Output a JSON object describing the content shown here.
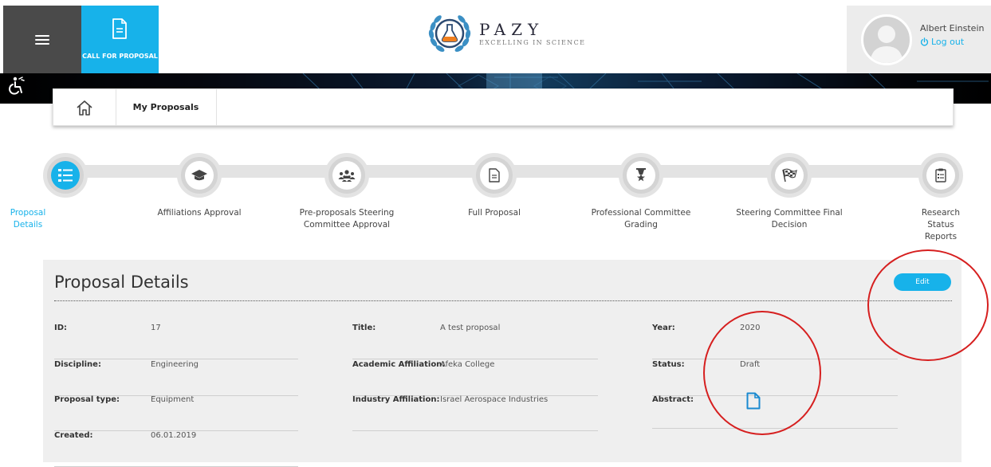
{
  "header": {
    "call_for_proposal_label": "CALL FOR PROPOSAL",
    "logo_name": "PAZY",
    "logo_tagline": "EXCELLING IN SCIENCE",
    "user_name": "Albert Einstein",
    "logout_label": "Log out"
  },
  "breadcrumb": {
    "current": "My Proposals"
  },
  "steps": [
    {
      "label": "Proposal Details",
      "icon": "list-icon",
      "active": true
    },
    {
      "label": "Affiliations Approval",
      "icon": "graduation-cap-icon",
      "active": false
    },
    {
      "label": "Pre-proposals Steering Committee Approval",
      "icon": "group-icon",
      "active": false
    },
    {
      "label": "Full Proposal",
      "icon": "document-icon",
      "active": false
    },
    {
      "label": "Professional Committee Grading",
      "icon": "award-icon",
      "active": false
    },
    {
      "label": "Steering Committee Final Decision",
      "icon": "checkered-flag-icon",
      "active": false
    },
    {
      "label": "Research Status Reports",
      "icon": "clipboard-icon",
      "active": false
    }
  ],
  "details": {
    "title": "Proposal Details",
    "edit_label": "Edit",
    "col1": [
      {
        "label": "ID:",
        "value": "17"
      },
      {
        "label": "Discipline:",
        "value": "Engineering"
      },
      {
        "label": "Proposal type:",
        "value": "Equipment"
      },
      {
        "label": "Created:",
        "value": "06.01.2019"
      }
    ],
    "col2": [
      {
        "label": "Title:",
        "value": "A test proposal"
      },
      {
        "label": "Academic Affiliation:",
        "value": "Afeka College"
      },
      {
        "label": "Industry Affiliation:",
        "value": "Israel Aerospace Industries"
      }
    ],
    "col3": [
      {
        "label": "Year:",
        "value": "2020"
      },
      {
        "label": "Status:",
        "value": "Draft"
      },
      {
        "label": "Abstract:",
        "value": ""
      }
    ]
  },
  "colors": {
    "accent": "#17b2ea",
    "menu_bg": "#4a4a4a",
    "annotation": "#d61f1f"
  }
}
